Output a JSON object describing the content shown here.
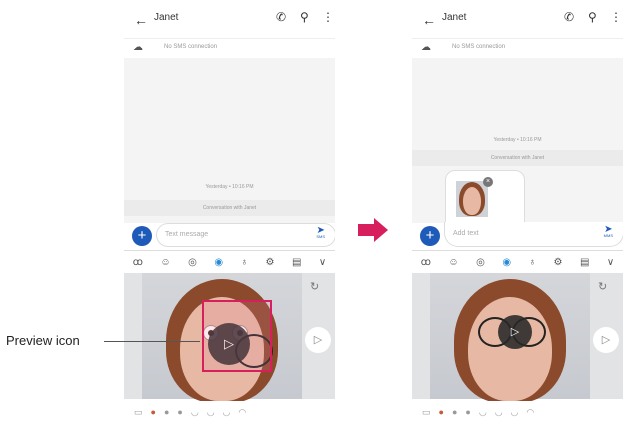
{
  "left_phone": {
    "contact_name": "Janet",
    "sms_notice": "No SMS connection",
    "timestamp": "Yesterday • 10:16 PM",
    "conversation_label": "Conversation with Janet",
    "input_placeholder": "Text message",
    "send_label": "SMS"
  },
  "right_phone": {
    "contact_name": "Janet",
    "sms_notice": "No SMS connection",
    "timestamp": "Yesterday • 10:16 PM",
    "conversation_label": "Conversation with Janet",
    "input_placeholder": "Add text",
    "send_label": "MMS"
  },
  "icons": {
    "back": "back-arrow-icon",
    "call": "phone-icon",
    "search": "search-icon",
    "more": "more-vert-icon",
    "cloud_off": "cloud-off-icon"
  },
  "toolbar_icons": [
    "sticker-icon",
    "emoji-icon",
    "gif-icon",
    "ar-emoji-icon",
    "mic-icon",
    "settings-icon",
    "clipboard-icon",
    "chevron-down-icon"
  ],
  "annotation": {
    "label": "Preview icon"
  },
  "colors": {
    "accent_blue": "#1e5ab8",
    "annotation_pink": "#d81f5e",
    "hair": "#8b4a2c"
  }
}
